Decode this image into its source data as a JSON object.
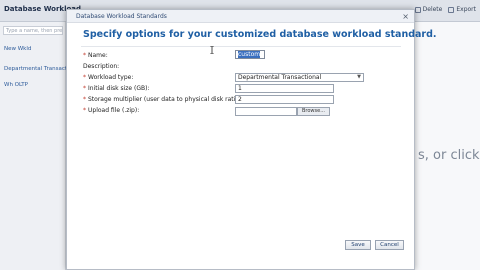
{
  "app": {
    "title": "Database Workload",
    "search_placeholder": "Type a name, then press Enter",
    "actions": [
      {
        "label": "Delete",
        "icon": "trash-icon"
      },
      {
        "label": "Export",
        "icon": "export-icon"
      }
    ],
    "nav_items": [
      "New Wkld",
      "Departmental Transactional",
      "Wh OLTP"
    ],
    "main_hint": "s, or click"
  },
  "dialog": {
    "title": "Database Workload Standards",
    "heading": "Specify options for your customized database workload standard.",
    "close_glyph": "×",
    "fields": {
      "name": {
        "label": "Name:",
        "required": true,
        "value": "custom"
      },
      "description": {
        "label": "Description:",
        "required": false
      },
      "workload_type": {
        "label": "Workload type:",
        "required": true,
        "value": "Departmental Transactional"
      },
      "initial_disk_size": {
        "label": "Initial disk size (GB):",
        "required": true,
        "value": "1"
      },
      "storage_multiplier": {
        "label": "Storage multiplier (user data to physical disk ratio):",
        "required": true,
        "value": "2"
      },
      "upload_file": {
        "label": "Upload file (.zip):",
        "required": true,
        "value": "",
        "browse_label": "Browse..."
      }
    },
    "buttons": {
      "save": "Save",
      "cancel": "Cancel"
    }
  }
}
